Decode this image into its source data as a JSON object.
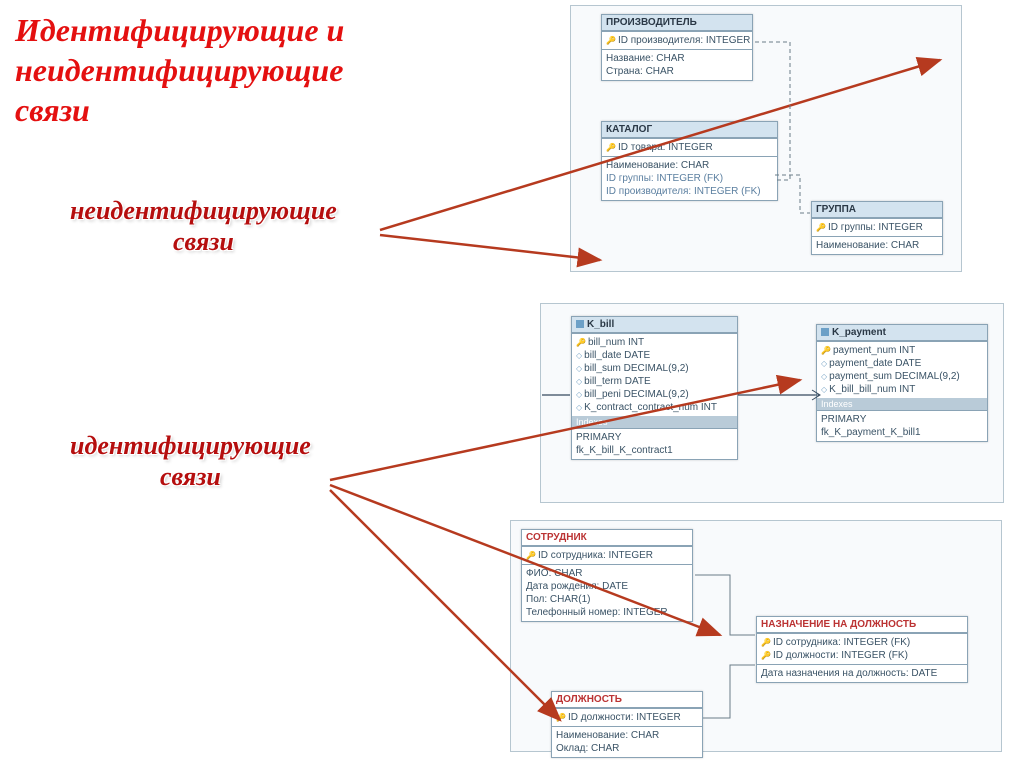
{
  "title": "Идентифицирующие и\nнеидентифицирующие\nсвязи",
  "label_nonident": "неидентифицирующие\nсвязи",
  "label_ident": "идентифицирующие\nсвязи",
  "diagram1": {
    "producer": {
      "title": "ПРОИЗВОДИТЕЛЬ",
      "pk": "ID производителя: INTEGER",
      "attrs": [
        "Название: CHAR",
        "Страна: CHAR"
      ]
    },
    "catalog": {
      "title": "КАТАЛОГ",
      "pk": "ID товара: INTEGER",
      "attrs": [
        "Наименование: CHAR",
        "ID группы: INTEGER (FK)",
        "ID производителя: INTEGER (FK)"
      ]
    },
    "group": {
      "title": "ГРУППА",
      "pk": "ID группы: INTEGER",
      "attrs": [
        "Наименование: CHAR"
      ]
    }
  },
  "diagram2": {
    "kbill": {
      "title": "K_bill",
      "cols": [
        "bill_num INT",
        "bill_date DATE",
        "bill_sum DECIMAL(9,2)",
        "bill_term DATE",
        "bill_peni DECIMAL(9,2)",
        "K_contract_contract_num INT"
      ],
      "idx": "Indexes",
      "idx_rows": [
        "PRIMARY",
        "fk_K_bill_K_contract1"
      ]
    },
    "kpayment": {
      "title": "K_payment",
      "cols": [
        "payment_num INT",
        "payment_date DATE",
        "payment_sum DECIMAL(9,2)",
        "K_bill_bill_num INT"
      ],
      "idx": "Indexes",
      "idx_rows": [
        "PRIMARY",
        "fk_K_payment_K_bill1"
      ]
    }
  },
  "diagram3": {
    "employee": {
      "title": "СОТРУДНИК",
      "pk": "ID сотрудника: INTEGER",
      "attrs": [
        "ФИО: CHAR",
        "Дата рождения: DATE",
        "Пол: CHAR(1)",
        "Телефонный номер: INTEGER"
      ]
    },
    "assignment": {
      "title": "НАЗНАЧЕНИЕ НА ДОЛЖНОСТЬ",
      "pks": [
        "ID сотрудника: INTEGER (FK)",
        "ID должности: INTEGER (FK)"
      ],
      "attrs": [
        "Дата назначения на должность: DATE"
      ]
    },
    "position": {
      "title": "ДОЛЖНОСТЬ",
      "pk": "ID должности: INTEGER",
      "attrs": [
        "Наименование: CHAR",
        "Оклад: CHAR"
      ]
    }
  }
}
